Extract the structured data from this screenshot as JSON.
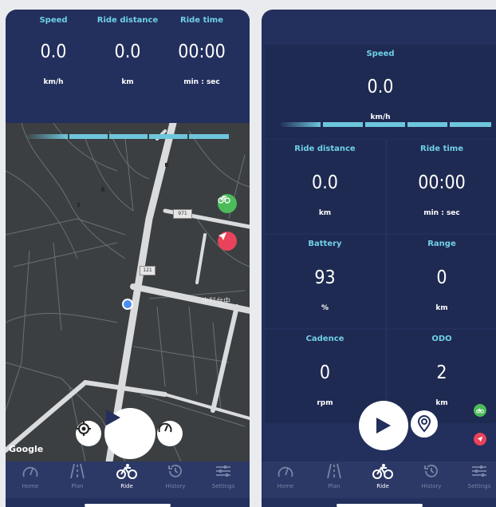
{
  "left": {
    "metrics": [
      {
        "label": "Speed",
        "value": "0.0",
        "unit": "km/h"
      },
      {
        "label": "Ride distance",
        "value": "0.0",
        "unit": "km"
      },
      {
        "label": "Ride time",
        "value": "00:00",
        "unit": "min : sec"
      }
    ],
    "map": {
      "road_labels": [
        "971",
        "121"
      ],
      "area_label": "中科台中",
      "attribution": "Google"
    }
  },
  "right": {
    "speed": {
      "label": "Speed",
      "value": "0.0",
      "unit": "km/h"
    },
    "cards": [
      {
        "label": "Ride distance",
        "value": "0.0",
        "unit": "km"
      },
      {
        "label": "Ride time",
        "value": "00:00",
        "unit": "min : sec"
      },
      {
        "label": "Battery",
        "value": "93",
        "unit": "%"
      },
      {
        "label": "Range",
        "value": "0",
        "unit": "km"
      },
      {
        "label": "Cadence",
        "value": "0",
        "unit": "rpm"
      },
      {
        "label": "ODO",
        "value": "2",
        "unit": "km"
      }
    ]
  },
  "nav": {
    "items": [
      {
        "label": "Home",
        "icon": "speedometer-icon"
      },
      {
        "label": "Plan",
        "icon": "road-icon"
      },
      {
        "label": "Ride",
        "icon": "bicycle-icon"
      },
      {
        "label": "History",
        "icon": "history-icon"
      },
      {
        "label": "Settings",
        "icon": "sliders-icon"
      }
    ],
    "active": "Ride"
  },
  "colors": {
    "background": "#232f5c",
    "card": "#1f2a52",
    "accent": "#6fd0e6",
    "map": "#3b3f42",
    "green_pin": "#4cbb5a",
    "red_pin": "#e8435a",
    "location_dot": "#4a8ef0"
  }
}
